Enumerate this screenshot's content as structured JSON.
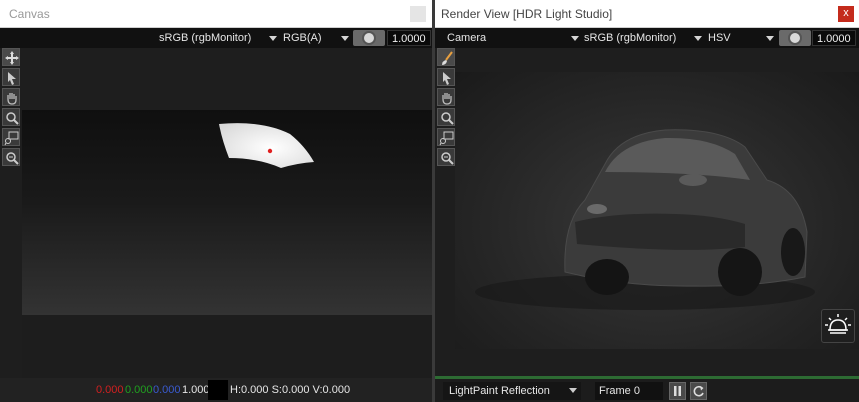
{
  "canvas_panel": {
    "title": "Canvas",
    "color_space": "sRGB (rgbMonitor)",
    "channels": "RGB(A)",
    "exposure": "1.0000",
    "tools": [
      "move-icon",
      "select-arrow-icon",
      "pan-hand-icon",
      "zoom-icon",
      "zoom-region-icon",
      "zoom-out-icon"
    ],
    "status": {
      "r": "0.000",
      "g": "0.000",
      "b": "0.000",
      "a": "1.000",
      "hsv": "H:0.000 S:0.000 V:0.000",
      "r_color": "#d02020",
      "g_color": "#20a020",
      "b_color": "#3a5bd0"
    }
  },
  "render_panel": {
    "title": "Render View [HDR Light Studio]",
    "close_label": "x",
    "camera": "Camera",
    "color_space": "sRGB (rgbMonitor)",
    "color_model": "HSV",
    "exposure": "1.0000",
    "tools": [
      "paint-brush-icon",
      "select-arrow-icon",
      "pan-hand-icon",
      "zoom-icon",
      "zoom-region-icon",
      "zoom-out-icon"
    ],
    "mode": "LightPaint Reflection",
    "frame_label": "Frame 0"
  },
  "colors": {
    "accent_green": "#2d6b33",
    "close_red": "#c42b1c"
  }
}
